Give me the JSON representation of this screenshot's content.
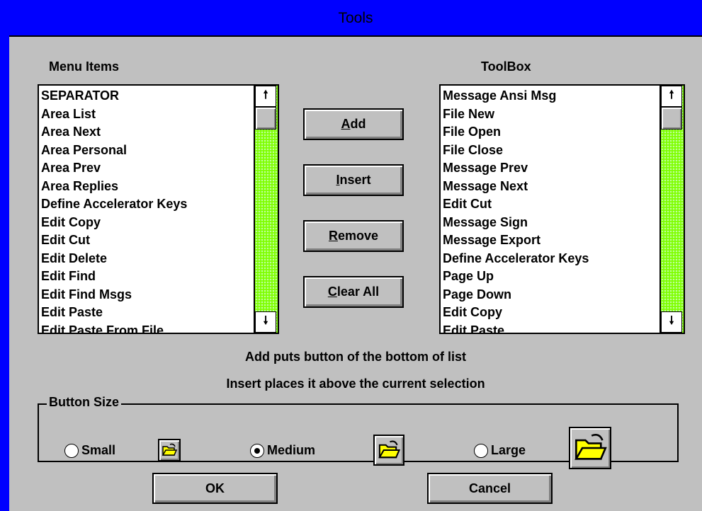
{
  "window": {
    "title": "Tools"
  },
  "menu_items": {
    "label": "Menu Items",
    "items": [
      "SEPARATOR",
      "Area List",
      "Area Next",
      "Area Personal",
      "Area Prev",
      "Area Replies",
      "Define Accelerator Keys",
      "Edit Copy",
      "Edit Cut",
      "Edit Delete",
      "Edit Find",
      "Edit Find Msgs",
      "Edit Paste",
      "Edit Paste From File"
    ]
  },
  "toolbox": {
    "label": "ToolBox",
    "items": [
      "Message Ansi Msg",
      "File New",
      "File Open",
      "File Close",
      "Message Prev",
      "Message Next",
      "Edit Cut",
      "Message Sign",
      "Message Export",
      "Define Accelerator Keys",
      "Page Up",
      "Page Down",
      "Edit Copy",
      "Edit Paste"
    ]
  },
  "actions": {
    "add": {
      "hotkey": "A",
      "rest": "dd"
    },
    "insert": {
      "hotkey": "I",
      "rest": "nsert"
    },
    "remove": {
      "hotkey": "R",
      "rest": "emove"
    },
    "clear_all": {
      "hotkey": "C",
      "rest": "lear All"
    }
  },
  "hints": {
    "line1": "Add puts button of the bottom of list",
    "line2": "Insert places it above the current selection"
  },
  "button_size": {
    "label": "Button Size",
    "small": "Small",
    "medium": "Medium",
    "large": "Large",
    "selected": "Medium"
  },
  "footer": {
    "ok": "OK",
    "cancel": "Cancel"
  },
  "colors": {
    "title_bar": "#0000ff",
    "scroll_track": "#7fff00",
    "face": "#c0c0c0"
  },
  "icons": [
    "arrow-up-icon",
    "arrow-down-icon",
    "open-folder-icon"
  ]
}
